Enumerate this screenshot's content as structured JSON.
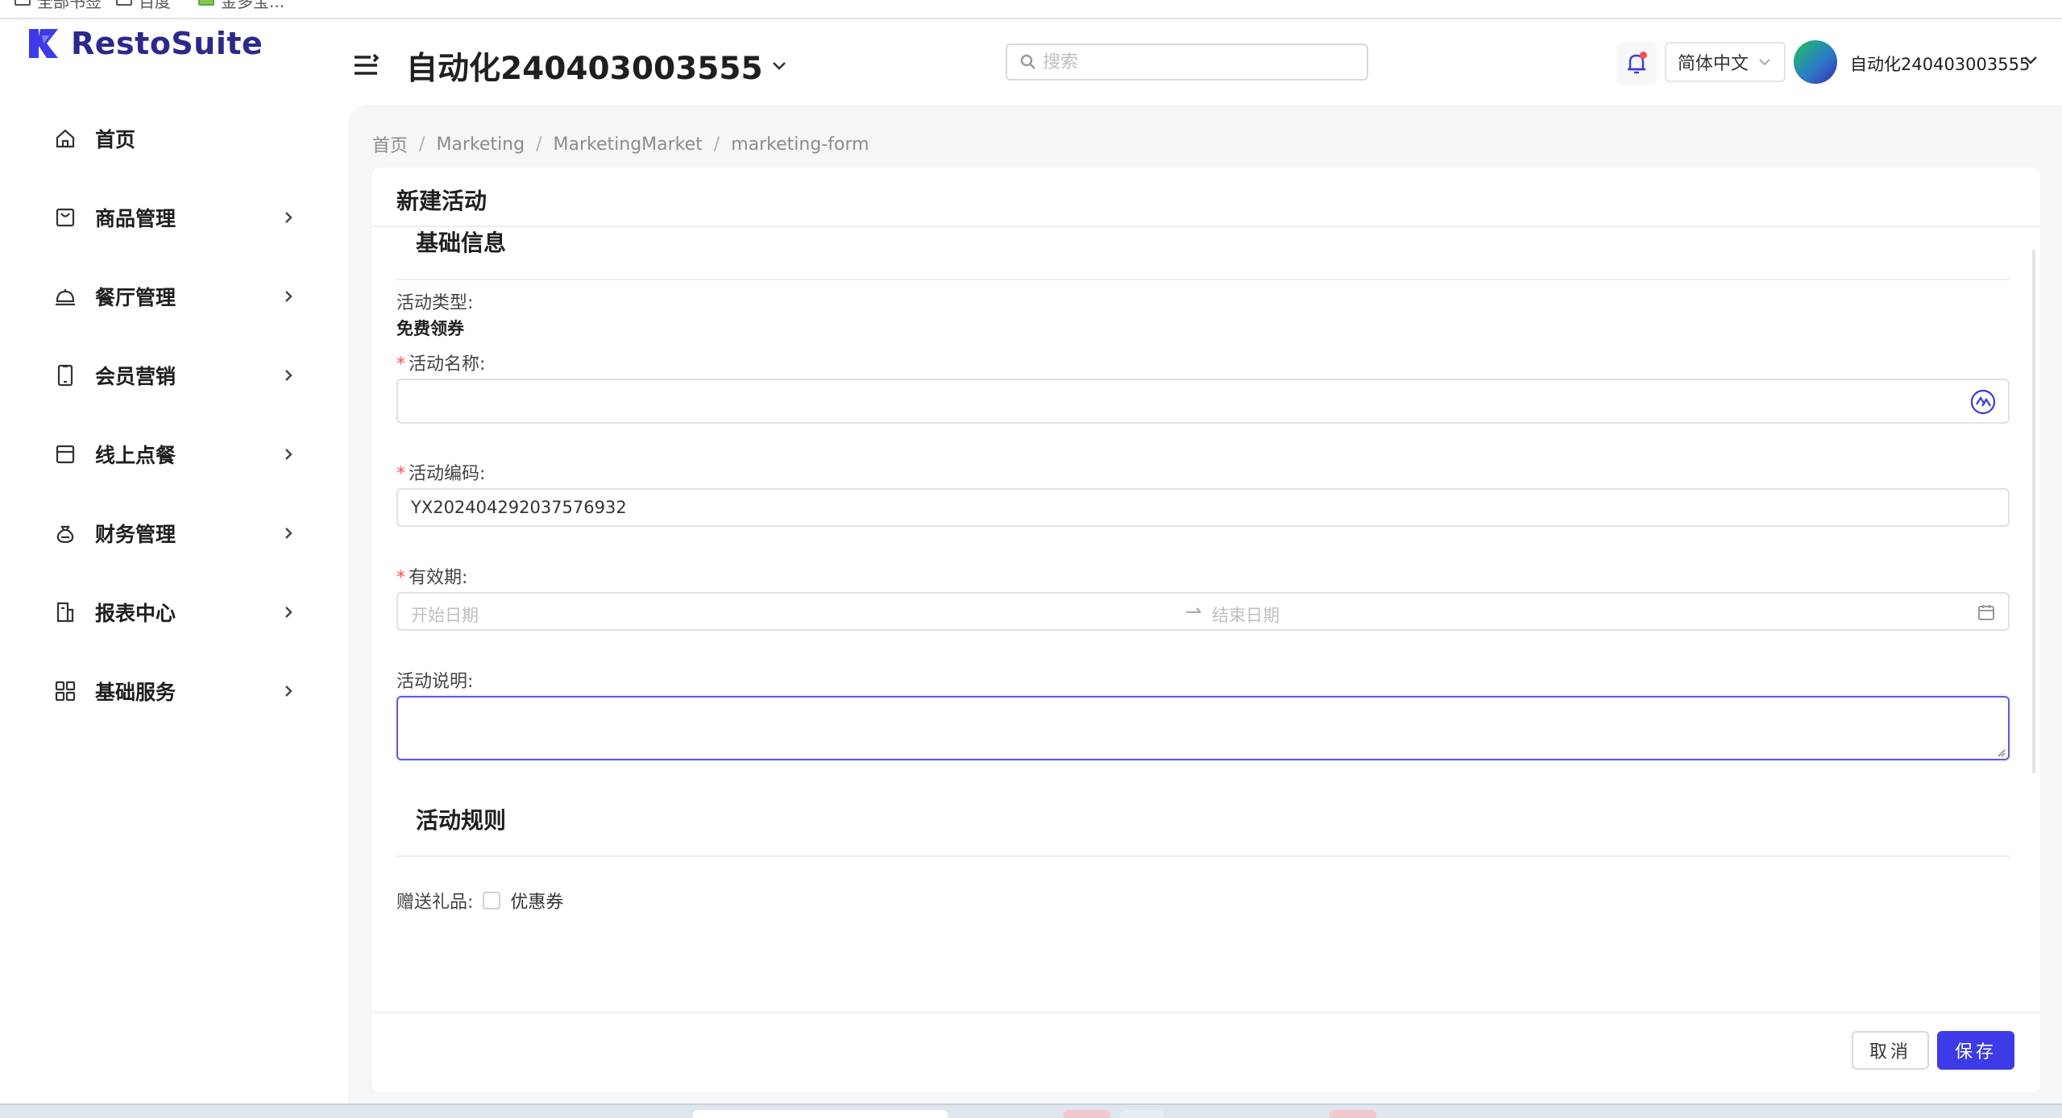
{
  "bookmarks": [
    "全部书签",
    "百度",
    "金多宝..."
  ],
  "brand": {
    "name": "RestoSuite",
    "accent": "#3d3be8",
    "logo_color": "#2b2a8c"
  },
  "sidebar": {
    "items": [
      {
        "label": "首页",
        "icon": "home-icon",
        "has_children": false
      },
      {
        "label": "商品管理",
        "icon": "bag-icon",
        "has_children": true
      },
      {
        "label": "餐厅管理",
        "icon": "cloche-icon",
        "has_children": true
      },
      {
        "label": "会员营销",
        "icon": "phone-icon",
        "has_children": true
      },
      {
        "label": "线上点餐",
        "icon": "box-icon",
        "has_children": true
      },
      {
        "label": "财务管理",
        "icon": "moneybag-icon",
        "has_children": true
      },
      {
        "label": "报表中心",
        "icon": "report-icon",
        "has_children": true
      },
      {
        "label": "基础服务",
        "icon": "grid-icon",
        "has_children": true
      }
    ]
  },
  "header": {
    "store_name": "自动化240403003555",
    "search_placeholder": "搜索",
    "language": "简体中文",
    "user_name": "自动化240403003555"
  },
  "breadcrumb": [
    "首页",
    "Marketing",
    "MarketingMarket",
    "marketing-form"
  ],
  "page": {
    "title": "新建活动",
    "sections": {
      "basic": "基础信息",
      "rules": "活动规则"
    },
    "fields": {
      "activity_type_label": "活动类型:",
      "activity_type_value": "免费领券",
      "name_label": "活动名称:",
      "name_value": "",
      "code_label": "活动编码:",
      "code_value": "YX202404292037576932",
      "validity_label": "有效期:",
      "start_placeholder": "开始日期",
      "end_placeholder": "结束日期",
      "desc_label": "活动说明:",
      "desc_value": "",
      "gift_label": "赠送礼品:",
      "gift_option": "优惠券"
    },
    "required_mark": "*",
    "buttons": {
      "cancel": "取消",
      "save": "保存"
    }
  }
}
